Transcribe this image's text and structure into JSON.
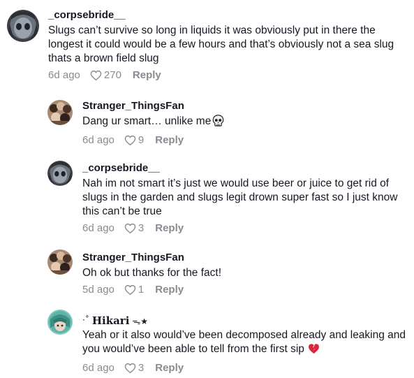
{
  "comments": [
    {
      "username": "_corpsebride__",
      "text": "Slugs can’t survive so long in liquids it was obviously put in there the longest it could would be a few hours and that’s obviously not a sea slug thats a brown field slug",
      "time": "6d ago",
      "likes": "270",
      "reply_label": "Reply",
      "avatar": "corpsebride-avatar"
    },
    {
      "username": "Stranger_ThingsFan",
      "text": "Dang ur smart… unlike me",
      "emoji": "skull-icon",
      "time": "6d ago",
      "likes": "9",
      "reply_label": "Reply",
      "avatar": "group-photo-avatar"
    },
    {
      "username": "_corpsebride__",
      "text": "Nah im not smart it’s just we would use beer or juice to get rid of slugs in the garden and slugs legit drown super fast so I just know this can’t be true",
      "time": "6d ago",
      "likes": "3",
      "reply_label": "Reply",
      "avatar": "corpsebride-avatar"
    },
    {
      "username": "Stranger_ThingsFan",
      "text": "Oh ok but thanks for the fact!",
      "time": "5d ago",
      "likes": "1",
      "reply_label": "Reply",
      "avatar": "group-photo-avatar"
    },
    {
      "username_prefix": "·˚",
      "username": "Hikari",
      "username_suffix": "ᯓ★",
      "text": "Yeah or it also would’ve been decomposed already and leaking and you would’ve been able to tell from the first sip",
      "emoji": "broken-heart-icon",
      "time": "6d ago",
      "likes": "3",
      "reply_label": "Reply",
      "avatar": "anime-avatar"
    }
  ],
  "colors": {
    "text": "#161823",
    "meta": "#8a8b91",
    "broken_heart": "#d8263a"
  }
}
